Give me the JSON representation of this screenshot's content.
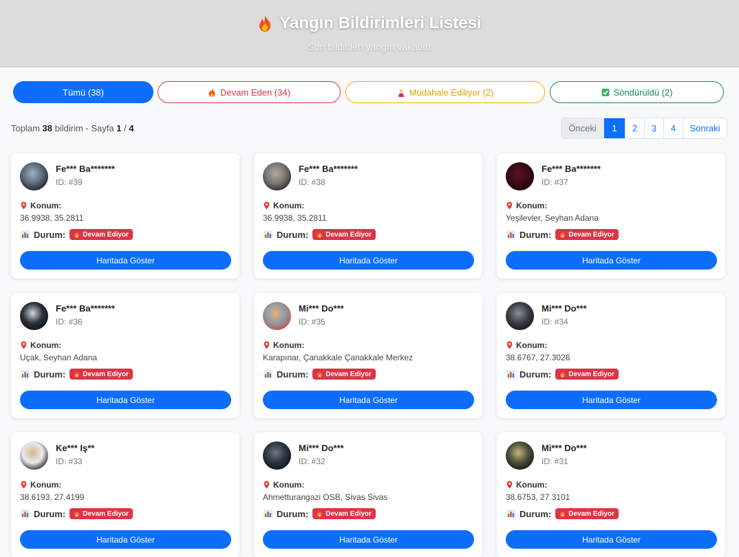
{
  "header": {
    "title": "Yangın Bildirimleri Listesi",
    "subtitle": "Son bildirilen yangın vakaları"
  },
  "filters": {
    "all": "Tümü (38)",
    "ongoing": "Devam Eden (34)",
    "responding": "Müdahale Ediliyor (2)",
    "done": "Söndürüldü (2)"
  },
  "summary": {
    "prefix": "Toplam",
    "total": "38",
    "mid": "bildirim - Sayfa",
    "page": "1",
    "sep": "/",
    "pages": "4"
  },
  "pagination": {
    "prev": "Önceki",
    "p1": "1",
    "p2": "2",
    "p3": "3",
    "p4": "4",
    "next": "Sonraki"
  },
  "labels": {
    "location": "Konum:",
    "status": "Durum:",
    "map_button": "Haritada Göster"
  },
  "cards": [
    {
      "name": "Fe*** Ba*******",
      "id": "ID: #39",
      "location": "36.9938, 35.2811",
      "status": "Devam Ediyor"
    },
    {
      "name": "Fe*** Ba*******",
      "id": "ID: #38",
      "location": "36.9938, 35.2811",
      "status": "Devam Ediyor"
    },
    {
      "name": "Fe*** Ba*******",
      "id": "ID: #37",
      "location": "Yeşilevler, Seyhan Adana",
      "status": "Devam Ediyor"
    },
    {
      "name": "Fe*** Ba*******",
      "id": "ID: #36",
      "location": "Uçak, Seyhan Adana",
      "status": "Devam Ediyor"
    },
    {
      "name": "Mi*** Do***",
      "id": "ID: #35",
      "location": "Karapınar, Çanakkale Çanakkale Merkez",
      "status": "Devam Ediyor"
    },
    {
      "name": "Mi*** Do***",
      "id": "ID: #34",
      "location": "38.6767, 27.3026",
      "status": "Devam Ediyor"
    },
    {
      "name": "Ke*** Iş**",
      "id": "ID: #33",
      "location": "38.6193, 27.4199",
      "status": "Devam Ediyor"
    },
    {
      "name": "Mi*** Do***",
      "id": "ID: #32",
      "location": "Ahmetturangazi OSB, Sivas Sivas",
      "status": "Devam Ediyor"
    },
    {
      "name": "Mi*** Do***",
      "id": "ID: #31",
      "location": "38.6753, 27.3101",
      "status": "Devam Ediyor"
    }
  ],
  "colors": {
    "primary": "#0d6efd",
    "danger": "#dc3545",
    "warning": "#f0ad00",
    "success": "#198754"
  },
  "icons": {
    "title": "fire-icon",
    "location": "pin-icon",
    "status": "bar-chart-icon",
    "badge": "fire-icon",
    "responding": "firefighter-icon",
    "done": "check-box-icon"
  }
}
